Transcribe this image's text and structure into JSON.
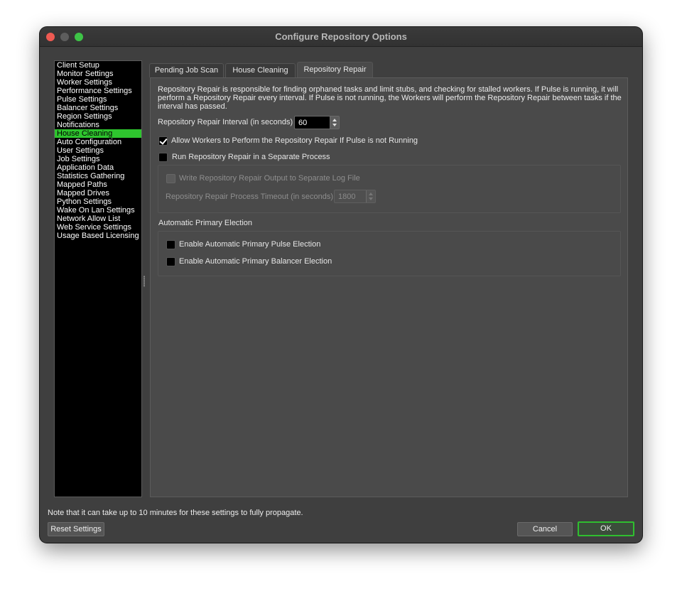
{
  "window": {
    "title": "Configure Repository Options"
  },
  "sidebar": {
    "items": [
      {
        "label": "Client Setup"
      },
      {
        "label": "Monitor Settings"
      },
      {
        "label": "Worker Settings"
      },
      {
        "label": "Performance Settings"
      },
      {
        "label": "Pulse Settings"
      },
      {
        "label": "Balancer Settings"
      },
      {
        "label": "Region Settings"
      },
      {
        "label": "Notifications"
      },
      {
        "label": "House Cleaning",
        "selected": true
      },
      {
        "label": "Auto Configuration"
      },
      {
        "label": "User Settings"
      },
      {
        "label": "Job Settings"
      },
      {
        "label": "Application Data"
      },
      {
        "label": "Statistics Gathering"
      },
      {
        "label": "Mapped Paths"
      },
      {
        "label": "Mapped Drives"
      },
      {
        "label": "Python Settings"
      },
      {
        "label": "Wake On Lan Settings"
      },
      {
        "label": "Network Allow List"
      },
      {
        "label": "Web Service Settings"
      },
      {
        "label": "Usage Based Licensing"
      }
    ],
    "selected_color": "#2ec52e"
  },
  "tabs": [
    {
      "label": "Pending Job Scan",
      "active": false
    },
    {
      "label": "House Cleaning",
      "active": false
    },
    {
      "label": "Repository Repair",
      "active": true
    }
  ],
  "repair": {
    "description": "Repository Repair is responsible for finding orphaned tasks and limit stubs, and checking for stalled workers. If Pulse is running, it will perform a Repository Repair every interval. If Pulse is not running, the Workers will perform the Repository Repair between tasks if the interval has passed.",
    "interval_label": "Repository Repair Interval (in seconds)",
    "interval_value": "60",
    "allow_workers_label": "Allow Workers to Perform the Repository Repair If Pulse is not Running",
    "allow_workers_checked": true,
    "separate_process_label": "Run Repository Repair in a Separate Process",
    "separate_process_checked": false,
    "write_log_label": "Write Repository Repair Output to Separate Log File",
    "write_log_checked": false,
    "timeout_label": "Repository Repair Process Timeout (in seconds)",
    "timeout_value": "1800"
  },
  "election": {
    "heading": "Automatic Primary Election",
    "pulse_label": "Enable Automatic Primary Pulse Election",
    "pulse_checked": false,
    "balancer_label": "Enable Automatic Primary Balancer Election",
    "balancer_checked": false
  },
  "footer": {
    "note": "Note that it can take up to 10 minutes for these settings to fully propagate.",
    "reset_label": "Reset Settings",
    "cancel_label": "Cancel",
    "ok_label": "OK"
  },
  "colors": {
    "accent_green": "#2fbf2f",
    "close": "#ee5a52",
    "maximize": "#3ec447"
  }
}
